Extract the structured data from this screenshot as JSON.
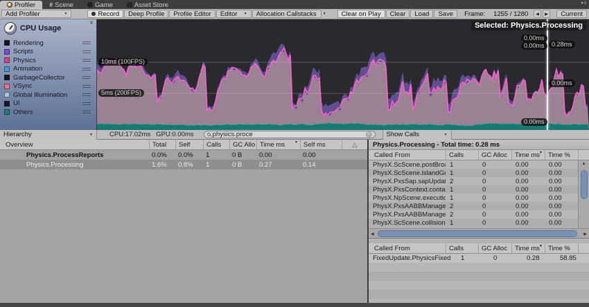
{
  "tabs": [
    {
      "label": "Profiler",
      "active": true
    },
    {
      "label": "Scene",
      "active": false
    },
    {
      "label": "Game",
      "active": false
    },
    {
      "label": "Asset Store",
      "active": false
    }
  ],
  "toolbar": {
    "add_profiler": "Add Profiler",
    "record": "Record",
    "deep_profile": "Deep Profile",
    "profile_editor": "Profile Editor",
    "editor": "Editor",
    "allocation_callstacks": "Allocation Callstacks",
    "clear_on_play": "Clear on Play",
    "clear": "Clear",
    "load": "Load",
    "save": "Save",
    "frame_label": "Frame:",
    "frame_value": "1255 / 1280",
    "current": "Current"
  },
  "legend": {
    "title": "CPU Usage",
    "items": [
      {
        "label": "Rendering",
        "color": "#161620"
      },
      {
        "label": "Scripts",
        "color": "#7d4bcd"
      },
      {
        "label": "Physics",
        "color": "#d8478c"
      },
      {
        "label": "Animation",
        "color": "#4f9ad6"
      },
      {
        "label": "GarbageCollector",
        "color": "#161620"
      },
      {
        "label": "VSync",
        "color": "#e87390"
      },
      {
        "label": "Global Illumination",
        "color": "#a9c6da"
      },
      {
        "label": "UI",
        "color": "#161620"
      },
      {
        "label": "Others",
        "color": "#1e7f74"
      }
    ]
  },
  "chart": {
    "selected_label": "Selected: Physics.Processing",
    "gridlines": [
      {
        "label": "10ms (100FPS)"
      },
      {
        "label": "5ms (200FPS)"
      }
    ],
    "markers": [
      {
        "label": "0.00ms"
      },
      {
        "label": "0.00ms"
      },
      {
        "label": "0.28ms"
      },
      {
        "label": "0.00ms"
      },
      {
        "label": "0.00ms"
      }
    ],
    "colors": {
      "background": "#29292e",
      "purple": "#5f5191",
      "mauve": "#9a8294",
      "line": "#f95fca",
      "teal": "#17796f"
    }
  },
  "midbar": {
    "view_mode": "Hierarchy",
    "cpu": "CPU:17.02ms",
    "gpu": "GPU:0.00ms",
    "search_value": "physics.proce",
    "show_calls": "Show Calls"
  },
  "overview": {
    "columns": [
      "Overview",
      "Total",
      "Self",
      "Calls",
      "GC Allo",
      "Time ms",
      "Self ms"
    ],
    "rows": [
      {
        "name": "Physics.ProcessReports",
        "total": "0.0%",
        "self": "0.0%",
        "calls": "1",
        "gc": "0 B",
        "time": "0.00",
        "selfms": "0.00"
      },
      {
        "name": "Physics.Processing",
        "total": "1.6%",
        "self": "0.8%",
        "calls": "1",
        "gc": "0 B",
        "time": "0.27",
        "selfms": "0.14"
      }
    ]
  },
  "detail": {
    "title": "Physics.Processing - Total time: 0.28 ms",
    "columns": [
      "Called From",
      "Calls",
      "GC Alloc",
      "Time ms",
      "Time %"
    ],
    "rows": [
      {
        "name": "PhysX.ScScene.postBroad",
        "calls": "1",
        "gc": "0",
        "time": "0.00",
        "pct": "0.00"
      },
      {
        "name": "PhysX.ScScene.islandGen",
        "calls": "1",
        "gc": "0",
        "time": "0.00",
        "pct": "0.00"
      },
      {
        "name": "PhysX.PxsSap.sapUpdate",
        "calls": "2",
        "gc": "0",
        "time": "0.00",
        "pct": "0.00"
      },
      {
        "name": "PhysX.PxsContext.contact",
        "calls": "1",
        "gc": "0",
        "time": "0.00",
        "pct": "0.00"
      },
      {
        "name": "PhysX.NpScene.execution",
        "calls": "1",
        "gc": "0",
        "time": "0.00",
        "pct": "0.00"
      },
      {
        "name": "PhysX.PxsAABBManager.a",
        "calls": "2",
        "gc": "0",
        "time": "0.00",
        "pct": "0.00"
      },
      {
        "name": "PhysX.PxsAABBManager.a",
        "calls": "2",
        "gc": "0",
        "time": "0.00",
        "pct": "0.00"
      },
      {
        "name": "PhysX.ScScene.collision",
        "calls": "1",
        "gc": "0",
        "time": "0.00",
        "pct": "0.00"
      }
    ],
    "bottom": {
      "columns": [
        "Called From",
        "Calls",
        "GC Alloc",
        "Time ms",
        "Time %"
      ],
      "rows": [
        {
          "name": "FixedUpdate.PhysicsFixed",
          "calls": "1",
          "gc": "0",
          "time": "0.28",
          "pct": "58.85"
        }
      ]
    }
  }
}
